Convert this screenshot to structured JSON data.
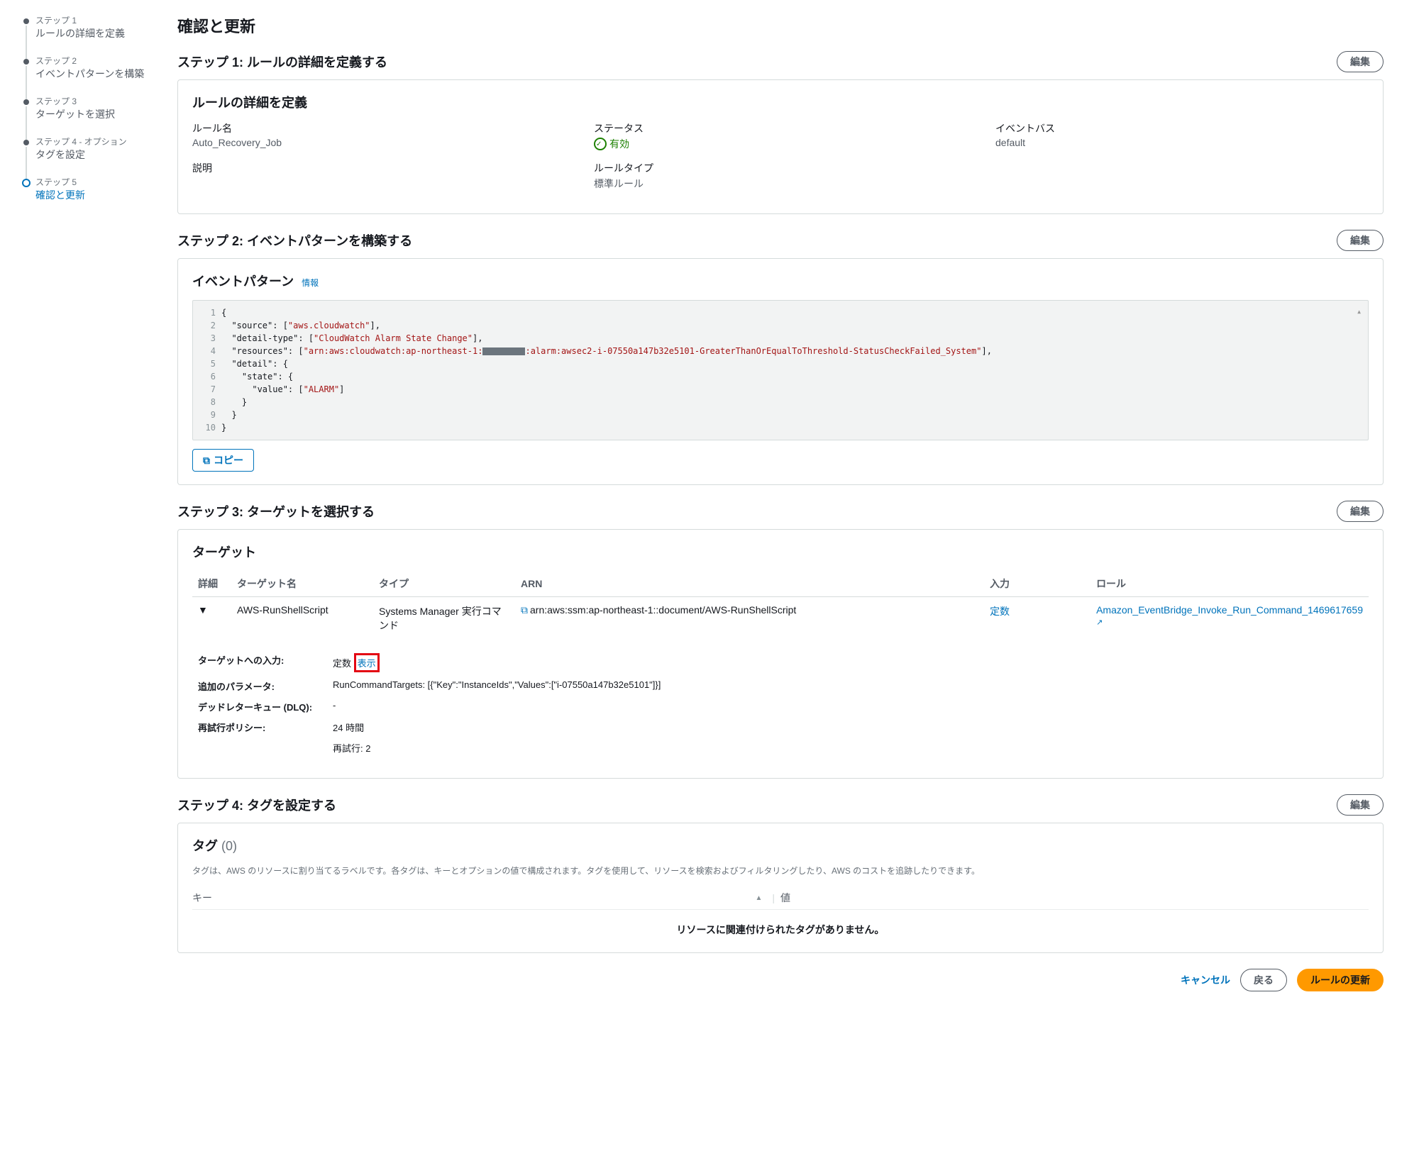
{
  "stepper": [
    {
      "num": "ステップ 1",
      "label": "ルールの詳細を定義"
    },
    {
      "num": "ステップ 2",
      "label": "イベントパターンを構築"
    },
    {
      "num": "ステップ 3",
      "label": "ターゲットを選択"
    },
    {
      "num": "ステップ 4 - オプション",
      "label": "タグを設定"
    },
    {
      "num": "ステップ 5",
      "label": "確認と更新"
    }
  ],
  "page_title": "確認と更新",
  "edit_label": "編集",
  "sections": {
    "s1": {
      "title": "ステップ 1: ルールの詳細を定義する",
      "panel_title": "ルールの詳細を定義",
      "rule_name_label": "ルール名",
      "rule_name": "Auto_Recovery_Job",
      "status_label": "ステータス",
      "status": "有効",
      "eventbus_label": "イベントバス",
      "eventbus": "default",
      "desc_label": "説明",
      "desc_value": "",
      "ruletype_label": "ルールタイプ",
      "ruletype": "標準ルール"
    },
    "s2": {
      "title": "ステップ 2: イベントパターンを構築する",
      "panel_title": "イベントパターン",
      "info": "情報",
      "code": {
        "l1": "{",
        "l2a": "  \"source\": [",
        "l2b": "\"aws.cloudwatch\"",
        "l2c": "],",
        "l3a": "  \"detail-type\": [",
        "l3b": "\"CloudWatch Alarm State Change\"",
        "l3c": "],",
        "l4a": "  \"resources\": [",
        "l4b": "\"arn:aws:cloudwatch:ap-northeast-1:",
        "l4c": ":alarm:awsec2-i-07550a147b32e5101-GreaterThanOrEqualToThreshold-StatusCheckFailed_System\"",
        "l4d": "],",
        "l5": "  \"detail\": {",
        "l6": "    \"state\": {",
        "l7a": "      \"value\": [",
        "l7b": "\"ALARM\"",
        "l7c": "]",
        "l8": "    }",
        "l9": "  }",
        "l10": "}"
      },
      "copy_label": "コピー"
    },
    "s3": {
      "title": "ステップ 3: ターゲットを選択する",
      "panel_title": "ターゲット",
      "cols": {
        "detail": "詳細",
        "name": "ターゲット名",
        "type": "タイプ",
        "arn": "ARN",
        "input": "入力",
        "role": "ロール"
      },
      "row": {
        "name": "AWS-RunShellScript",
        "type": "Systems Manager 実行コマンド",
        "arn": "arn:aws:ssm:ap-northeast-1::document/AWS-RunShellScript",
        "input": "定数",
        "role": "Amazon_EventBridge_Invoke_Run_Command_1469617659"
      },
      "detail": {
        "target_input_label": "ターゲットへの入力:",
        "target_input_val": "定数",
        "target_input_link": "表示",
        "add_param_label": "追加のパラメータ:",
        "add_param_val": "RunCommandTargets: [{\"Key\":\"InstanceIds\",\"Values\":[\"i-07550a147b32e5101\"]}]",
        "dlq_label": "デッドレターキュー (DLQ):",
        "dlq_val": "-",
        "retry_label": "再試行ポリシー:",
        "retry_val1": "24 時間",
        "retry_val2": "再試行: 2"
      }
    },
    "s4": {
      "title": "ステップ 4: タグを設定する",
      "panel_title": "タグ",
      "count": "(0)",
      "desc": "タグは、AWS のリソースに割り当てるラベルです。各タグは、キーとオプションの値で構成されます。タグを使用して、リソースを検索およびフィルタリングしたり、AWS のコストを追跡したりできます。",
      "col_key": "キー",
      "col_val": "値",
      "empty": "リソースに関連付けられたタグがありません。"
    }
  },
  "footer": {
    "cancel": "キャンセル",
    "back": "戻る",
    "submit": "ルールの更新"
  }
}
